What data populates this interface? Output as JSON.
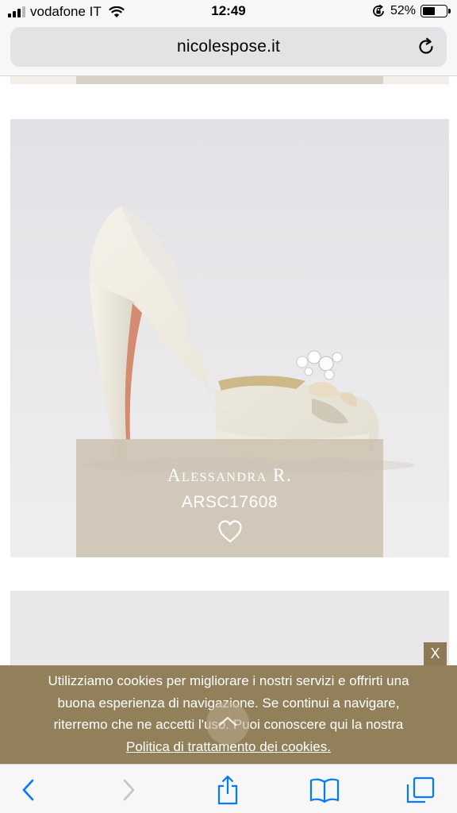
{
  "status_bar": {
    "carrier": "vodafone IT",
    "time": "12:49",
    "battery_percent": "52%",
    "battery_level": 0.52,
    "signal_bars": 4,
    "signal_bars_active": 3
  },
  "browser": {
    "url": "nicolespose.it",
    "accent_color": "#007aff"
  },
  "product": {
    "name": "Alessandra R.",
    "code": "ARSC17608",
    "favorite_icon": "heart-outline-icon",
    "caption_color": "#c9bead"
  },
  "cookie_banner": {
    "lines": [
      "Utilizziamo cookies per migliorare i nostri servizi e offrirti una",
      "buona esperienza di navigazione. Se continui a navigare,",
      "riterremo che ne accetti l'uso. Puoi conoscere qui la nostra"
    ],
    "link_text": "Politica di trattamento dei cookies.",
    "close_label": "X",
    "background_color": "#8e7b54"
  },
  "toolbar": {
    "icons": [
      "back-icon",
      "forward-icon",
      "share-icon",
      "bookmarks-icon",
      "tabs-icon"
    ]
  }
}
